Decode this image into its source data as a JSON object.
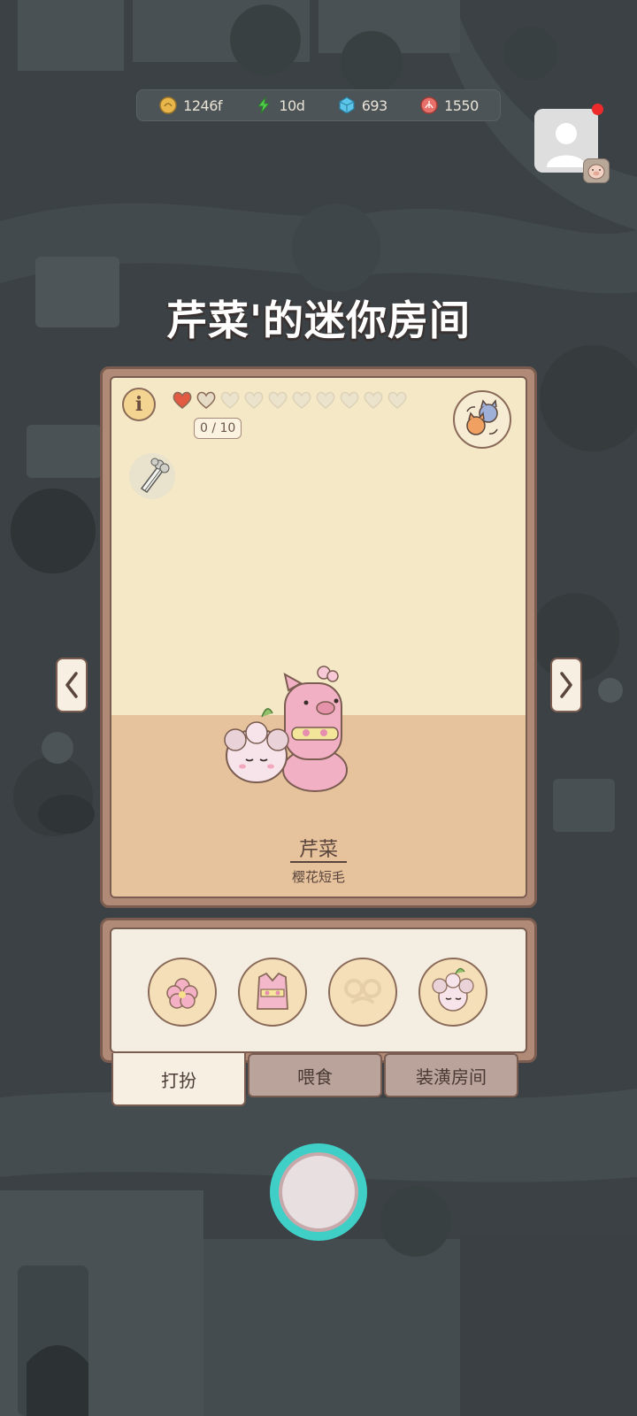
{
  "resources": [
    {
      "icon": "coin-icon",
      "value": "1246f",
      "color": "#e8b64a"
    },
    {
      "icon": "energy-icon",
      "value": "10d",
      "color": "#4fcc4a"
    },
    {
      "icon": "gem-icon",
      "value": "693",
      "color": "#5bc6e8"
    },
    {
      "icon": "shell-icon",
      "value": "1550",
      "color": "#e8706a"
    }
  ],
  "title": "芹菜'的迷你房间",
  "room": {
    "hearts_total": 10,
    "hearts_filled": 1,
    "progress": "0 / 10",
    "pet_name": "芹菜",
    "pet_breed": "樱花短毛"
  },
  "tabs": [
    {
      "label": "打扮",
      "active": true
    },
    {
      "label": "喂食",
      "active": false
    },
    {
      "label": "装潢房间",
      "active": false
    }
  ],
  "dress_slots": [
    "sakura-icon",
    "outfit-icon",
    "glasses-icon",
    "sheep-hat-icon"
  ],
  "colors": {
    "accent": "#3fcfc6",
    "frame": "#b08a76",
    "wall": "#f4e8c6",
    "floor": "#e6c29d",
    "heart_filled": "#e35a43"
  }
}
